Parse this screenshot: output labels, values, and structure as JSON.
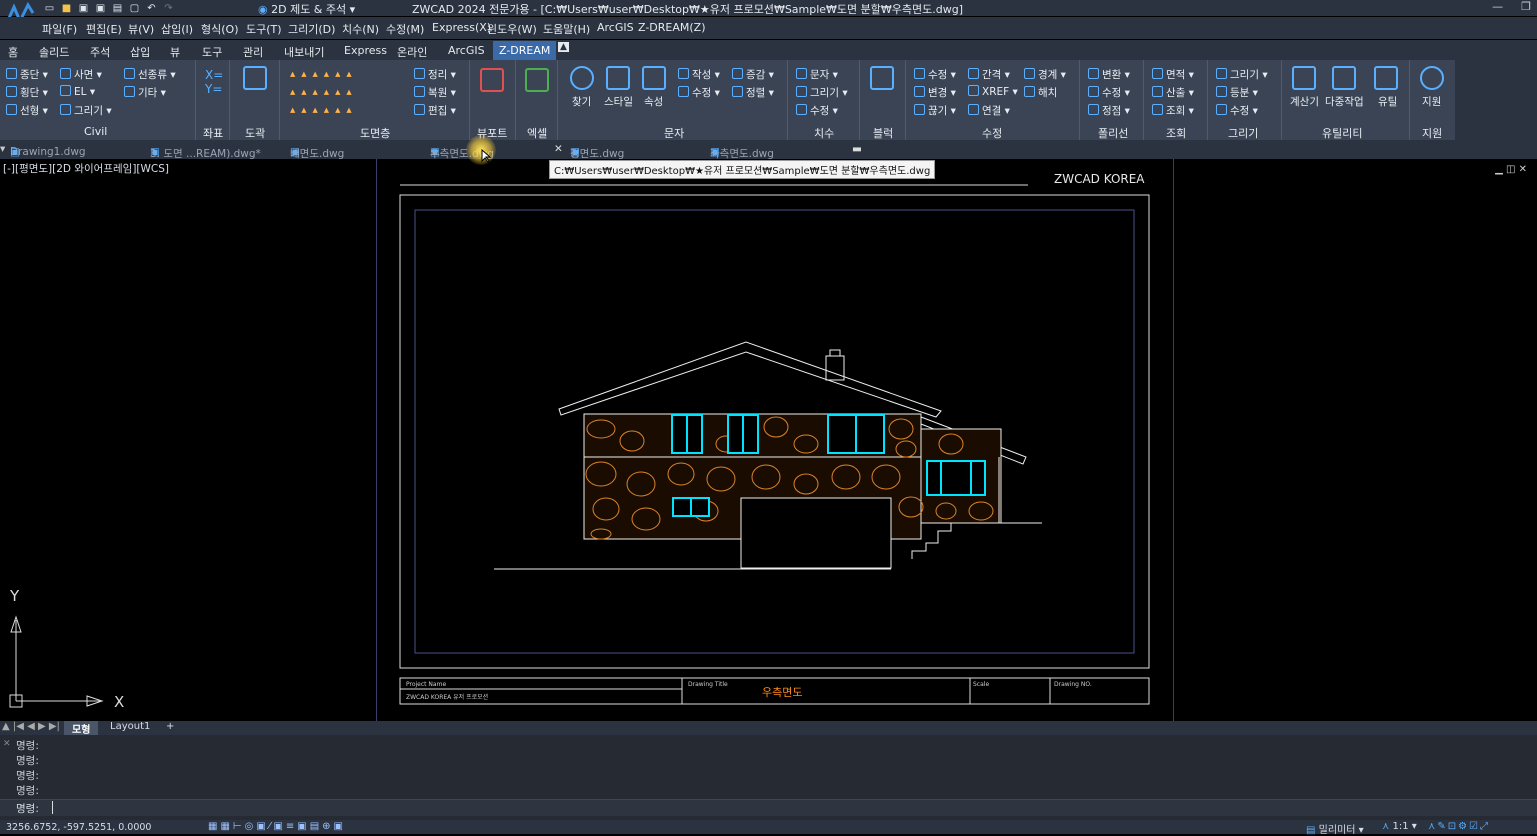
{
  "app": {
    "workspace": "2D 제도 & 주석",
    "window_title": "ZWCAD 2024 전문가용 - [C:₩Users₩user₩Desktop₩★유저 프로모션₩Sample₩도면 분할₩우측면도.dwg]"
  },
  "menu": [
    "파일(F)",
    "편집(E)",
    "뷰(V)",
    "삽입(I)",
    "형식(O)",
    "도구(T)",
    "그리기(D)",
    "치수(N)",
    "수정(M)",
    "Express(X)",
    "윈도우(W)",
    "도움말(H)",
    "ArcGIS",
    "Z-DREAM(Z)"
  ],
  "ribbon_tabs": [
    "홈",
    "솔리드",
    "주석",
    "삽입",
    "뷰",
    "도구",
    "관리",
    "내보내기",
    "Express",
    "온라인",
    "ArcGIS",
    "Z-DREAM"
  ],
  "ribbon_active_tab": "Z-DREAM",
  "ribbon": {
    "civil": {
      "label": "Civil",
      "items": [
        "종단",
        "횡단",
        "선형",
        "사면",
        "EL",
        "그리기",
        "선종류",
        "기타"
      ]
    },
    "coord": {
      "label": "좌표"
    },
    "frame": {
      "label": "도곽"
    },
    "sheet": {
      "label": "도면층",
      "items": [
        "정리",
        "복원",
        "편집"
      ]
    },
    "viewport": {
      "label": "뷰포트"
    },
    "excel": {
      "label": "엑셀"
    },
    "text": {
      "label": "문자",
      "items": [
        "찾기",
        "스타일",
        "속성",
        "작성",
        "수정",
        "증감",
        "정렬"
      ]
    },
    "dim": {
      "label": "치수",
      "items": [
        "문자",
        "그리기",
        "수정"
      ]
    },
    "block": {
      "label": "블럭"
    },
    "modify": {
      "label": "수정",
      "items": [
        "수정",
        "변경",
        "끊기",
        "간격",
        "XREF",
        "연결",
        "경계",
        "해치"
      ]
    },
    "polyline": {
      "label": "폴리선",
      "items": [
        "변환",
        "수정",
        "정점"
      ]
    },
    "query": {
      "label": "조회",
      "items": [
        "면적",
        "산출",
        "조회"
      ]
    },
    "draw": {
      "label": "그리기",
      "items": [
        "그리기",
        "등분",
        "수정"
      ]
    },
    "utility": {
      "label": "유틸리티",
      "items": [
        "계산기",
        "다중작업",
        "유틸"
      ]
    },
    "support": {
      "label": "지원",
      "items": [
        "지원"
      ]
    }
  },
  "doc_tabs": [
    "Drawing1.dwg",
    "3. 도면 ...REAM).dwg*",
    "배면도.dwg",
    "우측면도.dwg",
    "정면도.dwg",
    "좌측면도.dwg"
  ],
  "active_doc": "우측면도.dwg",
  "tooltip": "C:₩Users₩user₩Desktop₩★유저 프로모션₩Sample₩도면 분할₩우측면도.dwg",
  "view_label": "[-][평면도][2D 와이어프레임][WCS]",
  "drawing": {
    "company": "ZWCAD KOREA",
    "title_block": {
      "project_label": "Project Name",
      "project_value": "ZWCAD KOREA 유저 프로모션",
      "title_label": "Drawing Title",
      "title_value": "우측면도",
      "scale_label": "Scale",
      "number_label": "Drawing NO."
    }
  },
  "ucs": {
    "x": "X",
    "y": "Y"
  },
  "layout_tabs": [
    "모형",
    "Layout1",
    "+"
  ],
  "command_history": [
    "명령:",
    "명령:",
    "명령:",
    "명령:"
  ],
  "command_prompt": "명령:",
  "status": {
    "coords": "3256.6752, -597.5251, 0.0000",
    "units": "밀리미터",
    "scale": "1:1"
  },
  "colors": {
    "accent": "#3a6aa8",
    "window": "#00e5ff",
    "stone": "#d9822b",
    "title_orange": "#ff8c1a"
  }
}
